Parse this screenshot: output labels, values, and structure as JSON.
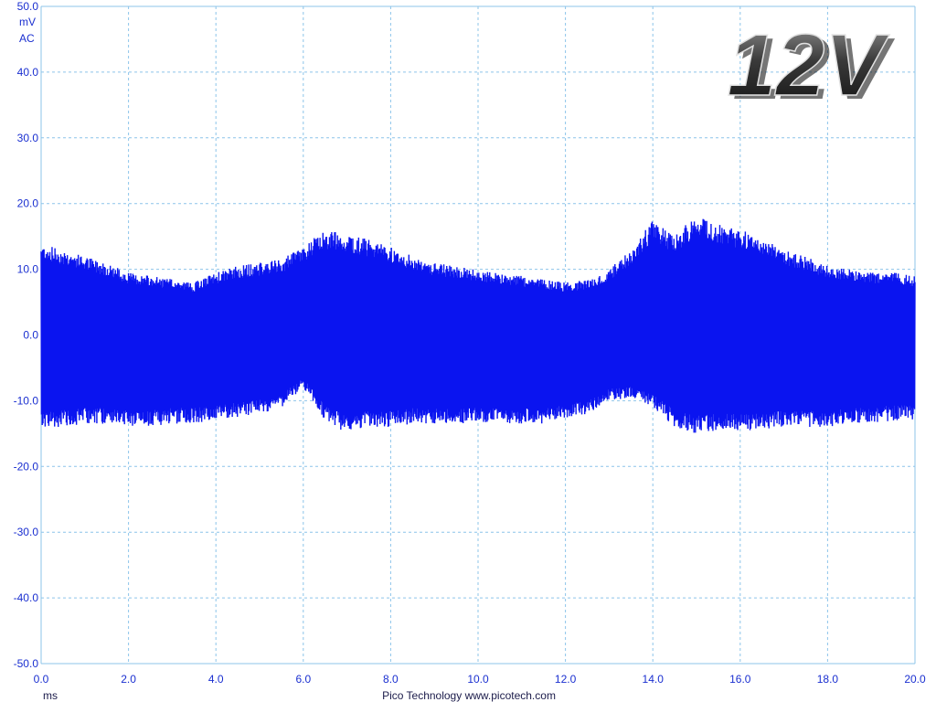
{
  "chart_data": {
    "type": "line",
    "title": "",
    "badge": "12V",
    "footer": "Pico Technology  www.picotech.com",
    "y_unit": "mV",
    "y_coupling": "AC",
    "xlabel": "ms",
    "ylabel": "mV",
    "xlim": [
      0.0,
      20.0
    ],
    "ylim": [
      -50.0,
      50.0
    ],
    "grid": true,
    "legend": "none",
    "x_ticks": [
      "0.0",
      "2.0",
      "4.0",
      "6.0",
      "8.0",
      "10.0",
      "12.0",
      "14.0",
      "16.0",
      "18.0",
      "20.0"
    ],
    "y_ticks": [
      "50.0",
      "40.0",
      "30.0",
      "20.0",
      "10.0",
      "0.0",
      "-10.0",
      "-20.0",
      "-30.0",
      "-40.0",
      "-50.0"
    ],
    "series": [
      {
        "color": "#0a14f0",
        "x": [
          0.0,
          0.5,
          1.0,
          1.5,
          2.0,
          2.5,
          3.0,
          3.5,
          4.0,
          4.5,
          5.0,
          5.5,
          6.0,
          6.5,
          7.0,
          7.5,
          8.0,
          8.5,
          9.0,
          9.5,
          10.0,
          10.5,
          11.0,
          11.5,
          12.0,
          12.5,
          13.0,
          13.5,
          14.0,
          14.5,
          15.0,
          15.5,
          16.0,
          16.5,
          17.0,
          17.5,
          18.0,
          18.5,
          19.0,
          19.5,
          20.0
        ],
        "y_max": [
          14.0,
          13.0,
          12.0,
          11.0,
          9.5,
          9.0,
          8.5,
          8.0,
          9.5,
          10.5,
          11.0,
          11.5,
          13.5,
          16.0,
          15.5,
          14.5,
          13.5,
          12.0,
          11.0,
          10.5,
          10.0,
          9.5,
          9.0,
          8.5,
          8.0,
          8.5,
          10.0,
          13.0,
          17.5,
          15.0,
          18.5,
          17.0,
          16.0,
          15.0,
          13.0,
          12.0,
          10.5,
          10.0,
          9.5,
          9.5,
          9.0
        ],
        "y_min": [
          -14.0,
          -14.0,
          -13.5,
          -13.5,
          -14.0,
          -14.0,
          -13.5,
          -13.5,
          -13.0,
          -12.5,
          -12.0,
          -11.0,
          -8.0,
          -13.0,
          -15.0,
          -14.0,
          -14.0,
          -13.5,
          -13.5,
          -13.5,
          -13.5,
          -13.5,
          -13.5,
          -13.5,
          -13.0,
          -12.0,
          -10.0,
          -9.5,
          -11.0,
          -14.0,
          -15.0,
          -14.5,
          -14.5,
          -14.5,
          -14.0,
          -14.0,
          -14.0,
          -13.5,
          -13.5,
          -13.0,
          -13.0
        ]
      }
    ]
  }
}
